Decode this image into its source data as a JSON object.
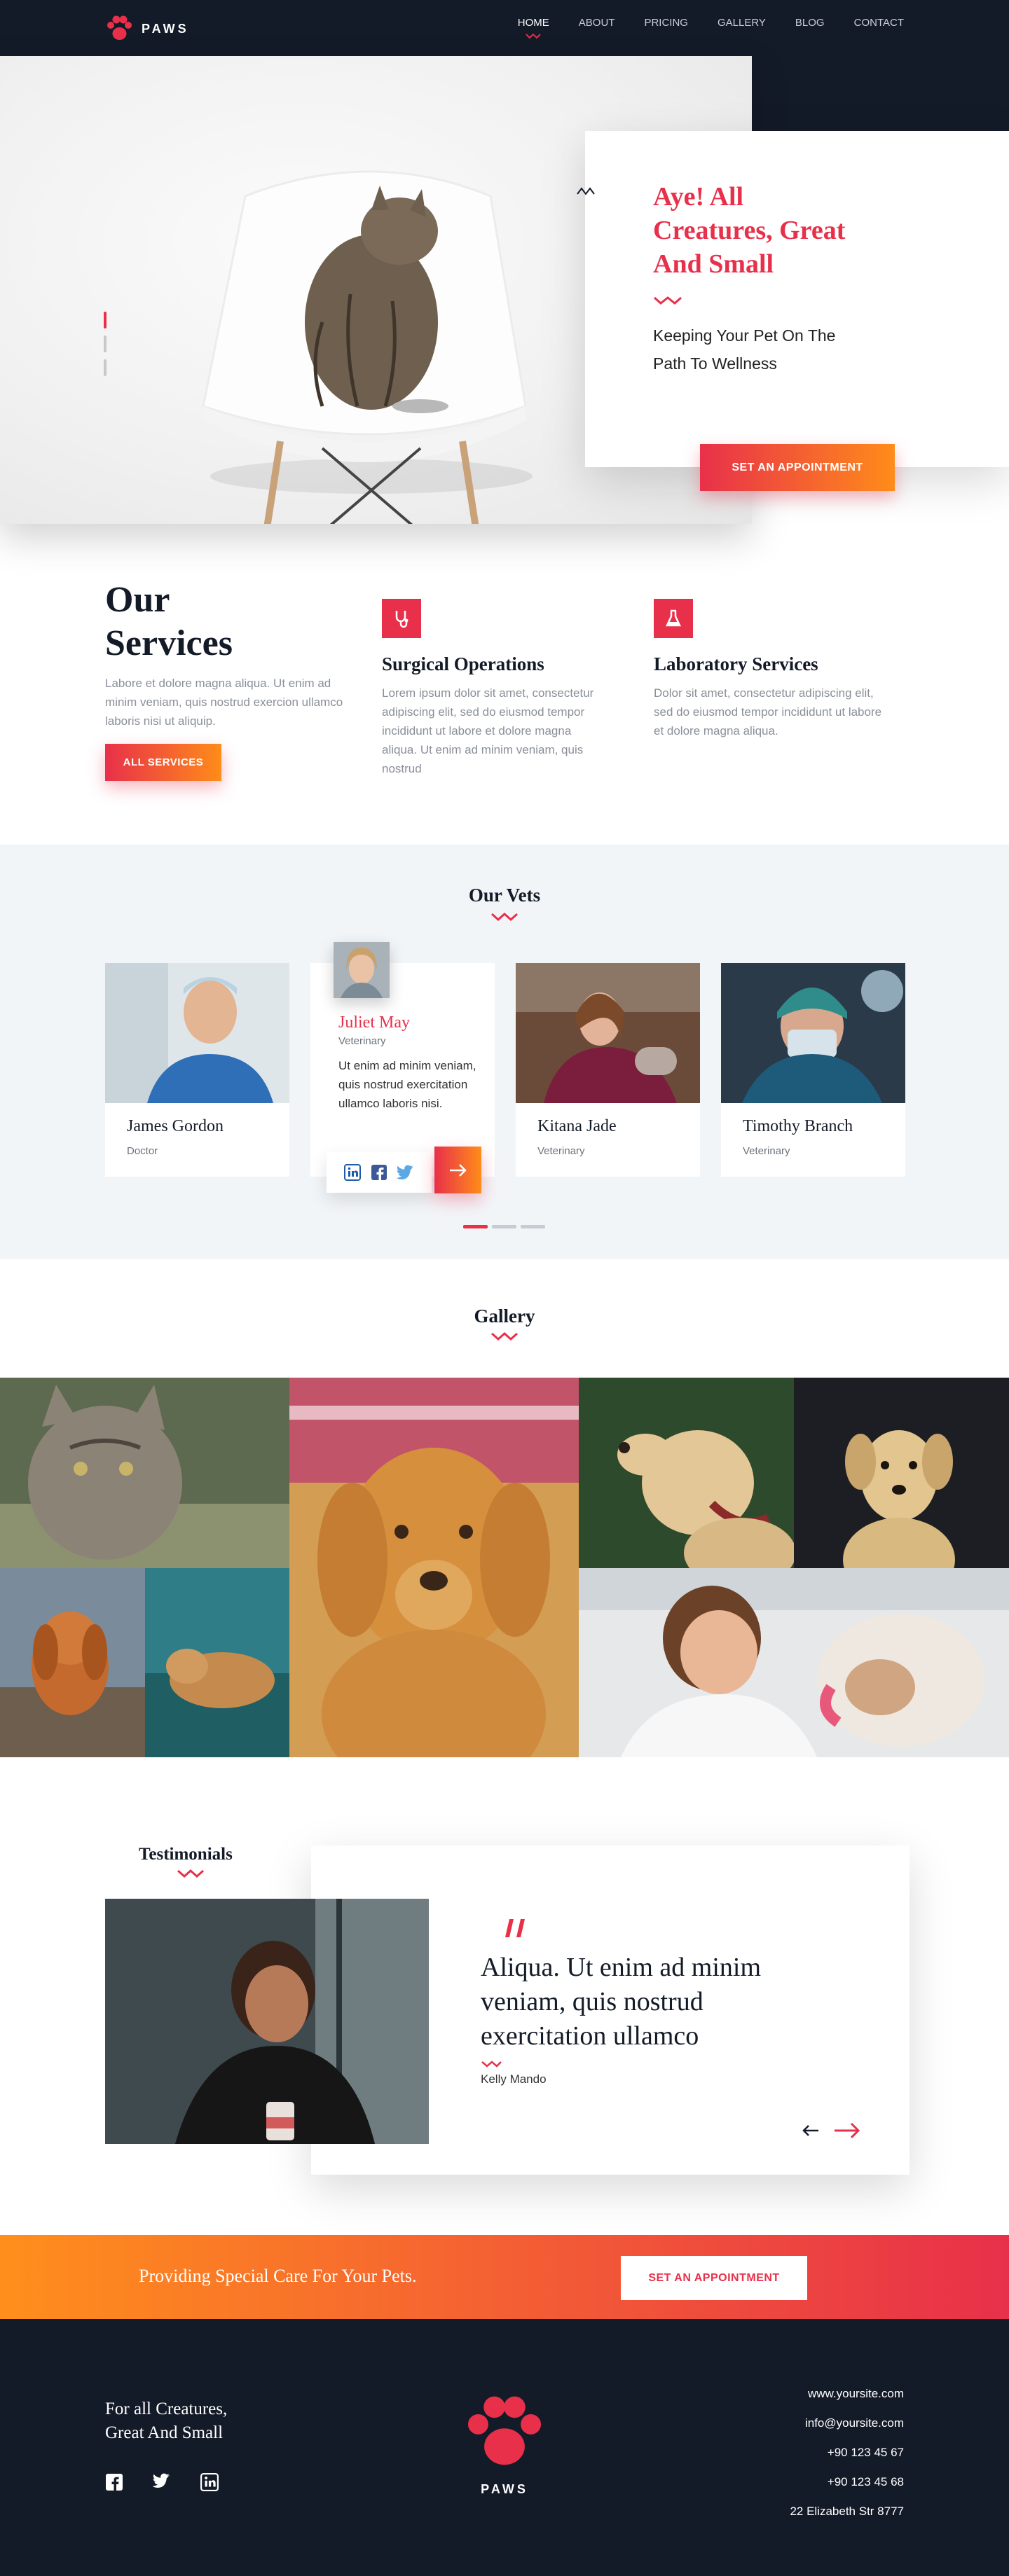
{
  "brand": {
    "name": "PAWS"
  },
  "nav": {
    "links": [
      {
        "label": "HOME",
        "active": true
      },
      {
        "label": "ABOUT"
      },
      {
        "label": "PRICING"
      },
      {
        "label": "GALLERY"
      },
      {
        "label": "BLOG"
      },
      {
        "label": "CONTACT"
      }
    ]
  },
  "hero": {
    "title": "Aye! All Creatures, Great And Small",
    "subtitle": "Keeping Your Pet On The Path To Wellness",
    "cta": "SET AN APPOINTMENT"
  },
  "services": {
    "title": "Our Services",
    "intro": "Labore et dolore magna aliqua. Ut enim ad minim veniam, quis nostrud exercion ullamco laboris nisi ut aliquip.",
    "button": "ALL SERVICES",
    "items": [
      {
        "title": "Surgical Operations",
        "text": "Lorem ipsum dolor sit amet, consectetur adipiscing elit, sed do eiusmod tempor incididunt ut labore et dolore magna aliqua. Ut enim ad minim veniam, quis nostrud",
        "icon": "stethoscope-icon"
      },
      {
        "title": "Laboratory Services",
        "text": "Dolor sit amet, consectetur adipiscing elit, sed do eiusmod tempor incididunt ut labore et dolore magna aliqua.",
        "icon": "flask-icon"
      }
    ]
  },
  "vets": {
    "title": "Our Vets",
    "featured": {
      "name": "Juliet May",
      "role": "Veterinary",
      "bio": "Ut enim ad minim veniam, quis nostrud exercitation ullamco laboris nisi."
    },
    "cards": [
      {
        "name": "James Gordon",
        "role": "Doctor"
      },
      {
        "name": "Kitana Jade",
        "role": "Veterinary"
      },
      {
        "name": "Timothy Branch",
        "role": "Veterinary"
      }
    ]
  },
  "gallery": {
    "title": "Gallery"
  },
  "testimonials": {
    "title": "Testimonials",
    "quote": "Aliqua. Ut enim ad minim veniam, quis nostrud exercitation ullamco",
    "author": "Kelly Mando"
  },
  "cta": {
    "text": "Providing Special Care For Your Pets.",
    "button": "SET AN APPOINTMENT"
  },
  "footer": {
    "tagline": "For all Creatures, Great And Small",
    "contact": [
      "www.yoursite.com",
      "info@yoursite.com",
      "+90 123 45 67",
      "+90 123 45 68",
      "22 Elizabeth Str 8777"
    ]
  },
  "colors": {
    "accent": "#e8304a",
    "orange": "#ff8c1a",
    "dark": "#141b28"
  }
}
